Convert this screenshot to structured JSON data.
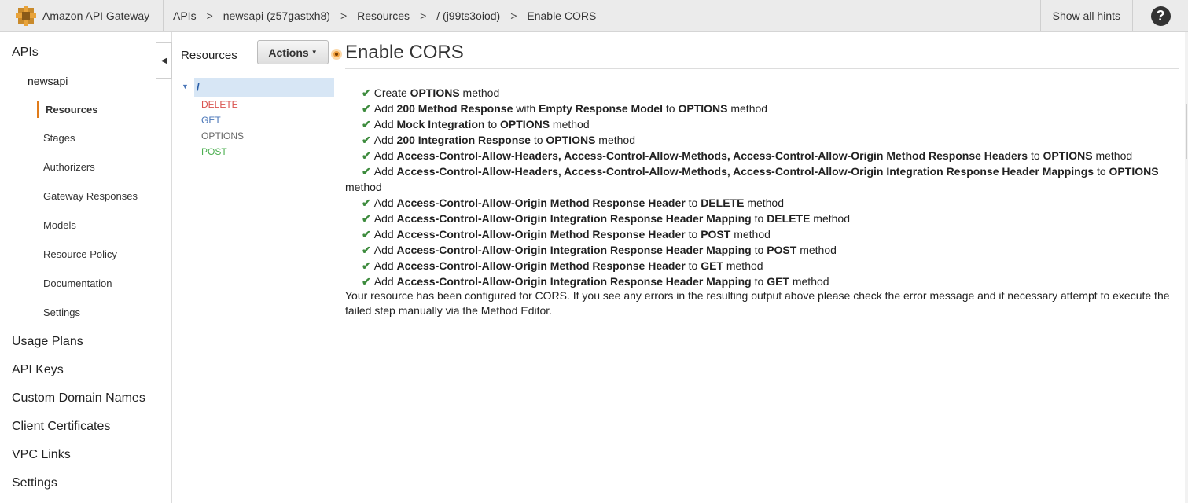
{
  "topbar": {
    "brand": "Amazon API Gateway",
    "breadcrumb": [
      "APIs",
      "newsapi (z57gastxh8)",
      "Resources",
      "/ (j99ts3oiod)",
      "Enable CORS"
    ],
    "separator": ">",
    "hints_label": "Show all hints",
    "help_glyph": "?"
  },
  "leftnav": {
    "top_items": [
      "APIs",
      "Usage Plans",
      "API Keys",
      "Custom Domain Names",
      "Client Certificates",
      "VPC Links",
      "Settings"
    ],
    "api_name": "newsapi",
    "sub_items": [
      "Resources",
      "Stages",
      "Authorizers",
      "Gateway Responses",
      "Models",
      "Resource Policy",
      "Documentation",
      "Settings"
    ],
    "active_sub": "Resources",
    "active_color": "#e07b1a"
  },
  "resources": {
    "title": "Resources",
    "actions_label": "Actions",
    "root": "/",
    "methods": [
      "DELETE",
      "GET",
      "OPTIONS",
      "POST"
    ]
  },
  "main": {
    "title": "Enable CORS",
    "steps": [
      [
        [
          "Create ",
          false
        ],
        [
          "OPTIONS",
          true
        ],
        [
          " method",
          false
        ]
      ],
      [
        [
          "Add ",
          false
        ],
        [
          "200 Method Response",
          true
        ],
        [
          " with ",
          false
        ],
        [
          "Empty Response Model",
          true
        ],
        [
          " to ",
          false
        ],
        [
          "OPTIONS",
          true
        ],
        [
          " method",
          false
        ]
      ],
      [
        [
          "Add ",
          false
        ],
        [
          "Mock Integration",
          true
        ],
        [
          " to ",
          false
        ],
        [
          "OPTIONS",
          true
        ],
        [
          " method",
          false
        ]
      ],
      [
        [
          "Add ",
          false
        ],
        [
          "200 Integration Response",
          true
        ],
        [
          " to ",
          false
        ],
        [
          "OPTIONS",
          true
        ],
        [
          " method",
          false
        ]
      ],
      [
        [
          "Add ",
          false
        ],
        [
          "Access-Control-Allow-Headers, Access-Control-Allow-Methods, Access-Control-Allow-Origin Method Response Headers",
          true
        ],
        [
          " to ",
          false
        ],
        [
          "OPTIONS",
          true
        ],
        [
          " method",
          false
        ]
      ],
      [
        [
          "Add ",
          false
        ],
        [
          "Access-Control-Allow-Headers, Access-Control-Allow-Methods, Access-Control-Allow-Origin Integration Response Header Mappings",
          true
        ],
        [
          " to ",
          false
        ],
        [
          "OPTIONS",
          true
        ],
        [
          " method",
          false
        ]
      ],
      [
        [
          "Add ",
          false
        ],
        [
          "Access-Control-Allow-Origin Method Response Header",
          true
        ],
        [
          " to ",
          false
        ],
        [
          "DELETE",
          true
        ],
        [
          " method",
          false
        ]
      ],
      [
        [
          "Add ",
          false
        ],
        [
          "Access-Control-Allow-Origin Integration Response Header Mapping",
          true
        ],
        [
          " to ",
          false
        ],
        [
          "DELETE",
          true
        ],
        [
          " method",
          false
        ]
      ],
      [
        [
          "Add ",
          false
        ],
        [
          "Access-Control-Allow-Origin Method Response Header",
          true
        ],
        [
          " to ",
          false
        ],
        [
          "POST",
          true
        ],
        [
          " method",
          false
        ]
      ],
      [
        [
          "Add ",
          false
        ],
        [
          "Access-Control-Allow-Origin Integration Response Header Mapping",
          true
        ],
        [
          " to ",
          false
        ],
        [
          "POST",
          true
        ],
        [
          " method",
          false
        ]
      ],
      [
        [
          "Add ",
          false
        ],
        [
          "Access-Control-Allow-Origin Method Response Header",
          true
        ],
        [
          " to ",
          false
        ],
        [
          "GET",
          true
        ],
        [
          " method",
          false
        ]
      ],
      [
        [
          "Add ",
          false
        ],
        [
          "Access-Control-Allow-Origin Integration Response Header Mapping",
          true
        ],
        [
          " to ",
          false
        ],
        [
          "GET",
          true
        ],
        [
          " method",
          false
        ]
      ]
    ],
    "check_glyph": "✔",
    "final_message": "Your resource has been configured for CORS. If you see any errors in the resulting output above please check the error message and if necessary attempt to execute the failed step manually via the Method Editor."
  }
}
